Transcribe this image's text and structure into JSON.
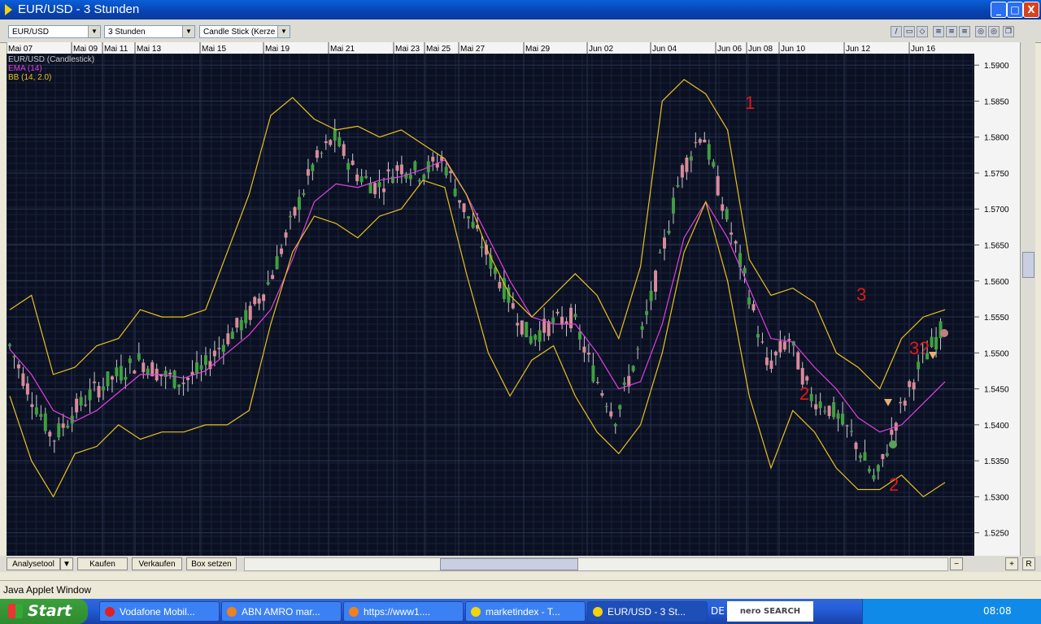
{
  "window": {
    "title": "EUR/USD - 3 Stunden",
    "min": "_",
    "max": "□",
    "close": "X"
  },
  "toolbar": {
    "symbol": "EUR/USD",
    "interval": "3 Stunden",
    "chart_type": "Candle Stick (Kerze"
  },
  "chart_data": {
    "type": "line",
    "legend": [
      "EUR/USD (Candlestick)",
      "EMA (14)",
      "BB (14, 2.0)"
    ],
    "legend_colors": [
      "#c8c8c8",
      "#e040e0",
      "#e8c020"
    ],
    "x_ticks": [
      "Mai 07",
      "Mai 09",
      "Mai 11",
      "Mai 13",
      "Mai 15",
      "Mai 19",
      "Mai 21",
      "Mai 23",
      "Mai 25",
      "Mai 27",
      "Mai 29",
      "Jun 02",
      "Jun 04",
      "Jun 06",
      "Jun 08",
      "Jun 10",
      "Jun 12",
      "Jun 16"
    ],
    "y_ticks": [
      "1.5900",
      "1.5850",
      "1.5800",
      "1.5750",
      "1.5700",
      "1.5650",
      "1.5600",
      "1.5550",
      "1.5500",
      "1.5450",
      "1.5400",
      "1.5350",
      "1.5300",
      "1.5250"
    ],
    "ylim": [
      1.5218,
      1.5916
    ],
    "series": [
      {
        "values": [
          1.551,
          1.544,
          1.538,
          1.542,
          1.545,
          1.547,
          1.549,
          1.547,
          1.546,
          1.548,
          1.552,
          1.555,
          1.56,
          1.568,
          1.576,
          1.58,
          1.575,
          1.573,
          1.576,
          1.575,
          1.577,
          1.57,
          1.564,
          1.558,
          1.552,
          1.554,
          1.555,
          1.547,
          1.541,
          1.55,
          1.562,
          1.575,
          1.581,
          1.57,
          1.56,
          1.548,
          1.552,
          1.544,
          1.542,
          1.538,
          1.532,
          1.541,
          1.548,
          1.553
        ]
      },
      {
        "values": [
          1.5505,
          1.547,
          1.542,
          1.5405,
          1.542,
          1.5445,
          1.547,
          1.547,
          1.5465,
          1.5475,
          1.55,
          1.5525,
          1.556,
          1.563,
          1.571,
          1.5735,
          1.573,
          1.574,
          1.5745,
          1.5755,
          1.5768,
          1.572,
          1.566,
          1.56,
          1.555,
          1.554,
          1.554,
          1.55,
          1.545,
          1.546,
          1.554,
          1.566,
          1.571,
          1.566,
          1.559,
          1.552,
          1.5515,
          1.548,
          1.545,
          1.541,
          1.539,
          1.54,
          1.543,
          1.546
        ]
      },
      {
        "values": [
          1.556,
          1.558,
          1.547,
          1.548,
          1.551,
          1.552,
          1.556,
          1.555,
          1.555,
          1.556,
          1.564,
          1.572,
          1.583,
          1.5855,
          1.5825,
          1.581,
          1.5815,
          1.58,
          1.581,
          1.579,
          1.577,
          1.572,
          1.564,
          1.558,
          1.555,
          1.558,
          1.561,
          1.558,
          1.552,
          1.562,
          1.585,
          1.588,
          1.586,
          1.581,
          1.563,
          1.558,
          1.559,
          1.557,
          1.55,
          1.548,
          1.545,
          1.552,
          1.555,
          1.556
        ]
      },
      {
        "values": [
          1.544,
          1.535,
          1.53,
          1.536,
          1.537,
          1.54,
          1.538,
          1.539,
          1.539,
          1.54,
          1.54,
          1.542,
          1.554,
          1.564,
          1.569,
          1.568,
          1.566,
          1.569,
          1.57,
          1.574,
          1.573,
          1.561,
          1.55,
          1.544,
          1.549,
          1.551,
          1.544,
          1.539,
          1.536,
          1.54,
          1.55,
          1.564,
          1.571,
          1.56,
          1.544,
          1.534,
          1.542,
          1.539,
          1.534,
          1.531,
          1.531,
          1.533,
          1.53,
          1.532
        ]
      }
    ],
    "annotations": [
      "1",
      "2",
      "3",
      "2",
      "3?"
    ]
  },
  "bottom": {
    "analyse": "Analysetool",
    "buy": "Kaufen",
    "sell": "Verkaufen",
    "box": "Box setzen",
    "r": "R"
  },
  "status_text": "Java Applet Window",
  "taskbar": {
    "start": "Start",
    "tasks": [
      "Vodafone Mobil...",
      "ABN AMRO mar...",
      "https://www1....",
      "marketindex - T...",
      "EUR/USD - 3 St..."
    ],
    "lang": "DE",
    "search": "nero SEARCH",
    "clock": "08:08"
  }
}
